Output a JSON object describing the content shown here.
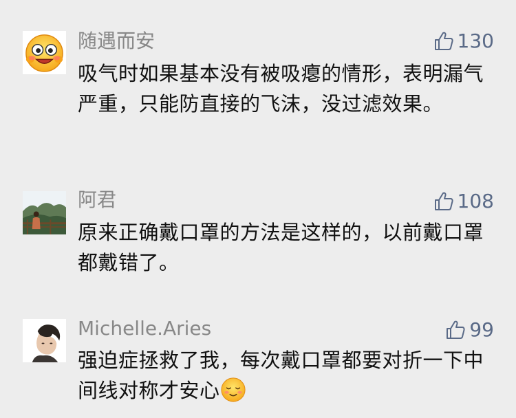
{
  "comments": [
    {
      "username": "随遇而安",
      "likes": "130",
      "text": "吸气时如果基本没有被吸瘪的情形，表明漏气严重，只能防直接的飞沫，没过滤效果。"
    },
    {
      "username": "阿君",
      "likes": "108",
      "text": "原来正确戴口罩的方法是这样的，以前戴口罩都戴错了。"
    },
    {
      "username": "Michelle.Aries",
      "likes": "99",
      "text": "强迫症拯救了我，每次戴口罩都要对折一下中间线对称才安心",
      "trailing_emoji": "relieved-face-emoji"
    }
  ],
  "colors": {
    "background": "#ededed",
    "username": "#888888",
    "likes": "#5a6a87",
    "text": "#111111"
  },
  "icons": {
    "like": "thumbs-up-icon"
  }
}
